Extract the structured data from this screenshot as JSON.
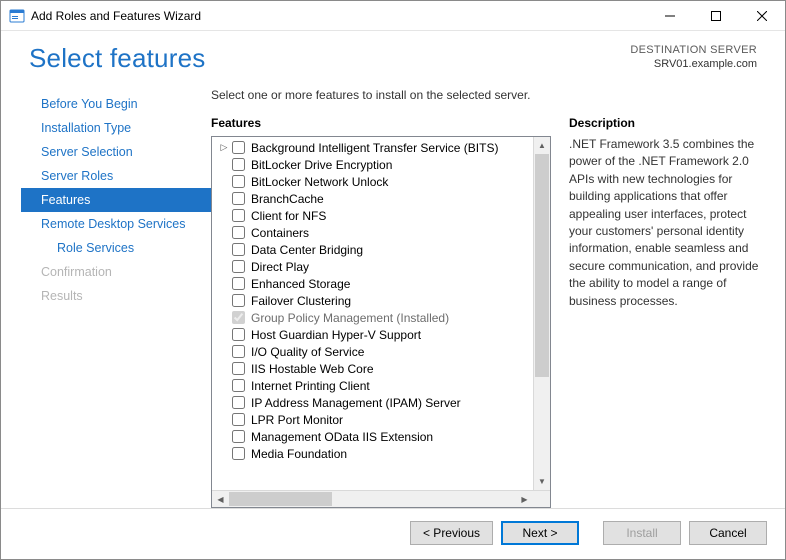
{
  "titlebar": {
    "title": "Add Roles and Features Wizard"
  },
  "header": {
    "page_title": "Select features",
    "dest_label": "DESTINATION SERVER",
    "dest_server": "SRV01.example.com"
  },
  "nav": {
    "items": [
      {
        "label": "Before You Begin",
        "state": "normal"
      },
      {
        "label": "Installation Type",
        "state": "normal"
      },
      {
        "label": "Server Selection",
        "state": "normal"
      },
      {
        "label": "Server Roles",
        "state": "normal"
      },
      {
        "label": "Features",
        "state": "current"
      },
      {
        "label": "Remote Desktop Services",
        "state": "normal"
      },
      {
        "label": "Role Services",
        "state": "normal",
        "indent": true
      },
      {
        "label": "Confirmation",
        "state": "disabled"
      },
      {
        "label": "Results",
        "state": "disabled"
      }
    ]
  },
  "main": {
    "instruction": "Select one or more features to install on the selected server.",
    "features_heading": "Features",
    "description_heading": "Description",
    "description_text": ".NET Framework 3.5 combines the power of the .NET Framework 2.0 APIs with new technologies for building applications that offer appealing user interfaces, protect your customers' personal identity information, enable seamless and secure communication, and provide the ability to model a range of business processes.",
    "features": [
      {
        "label": "Background Intelligent Transfer Service (BITS)",
        "checked": false,
        "expandable": true
      },
      {
        "label": "BitLocker Drive Encryption",
        "checked": false
      },
      {
        "label": "BitLocker Network Unlock",
        "checked": false
      },
      {
        "label": "BranchCache",
        "checked": false
      },
      {
        "label": "Client for NFS",
        "checked": false
      },
      {
        "label": "Containers",
        "checked": false
      },
      {
        "label": "Data Center Bridging",
        "checked": false
      },
      {
        "label": "Direct Play",
        "checked": false
      },
      {
        "label": "Enhanced Storage",
        "checked": false
      },
      {
        "label": "Failover Clustering",
        "checked": false
      },
      {
        "label": "Group Policy Management (Installed)",
        "checked": true,
        "installed": true
      },
      {
        "label": "Host Guardian Hyper-V Support",
        "checked": false
      },
      {
        "label": "I/O Quality of Service",
        "checked": false
      },
      {
        "label": "IIS Hostable Web Core",
        "checked": false
      },
      {
        "label": "Internet Printing Client",
        "checked": false
      },
      {
        "label": "IP Address Management (IPAM) Server",
        "checked": false
      },
      {
        "label": "LPR Port Monitor",
        "checked": false
      },
      {
        "label": "Management OData IIS Extension",
        "checked": false
      },
      {
        "label": "Media Foundation",
        "checked": false
      }
    ]
  },
  "footer": {
    "previous": "< Previous",
    "next": "Next >",
    "install": "Install",
    "cancel": "Cancel",
    "install_enabled": false
  }
}
